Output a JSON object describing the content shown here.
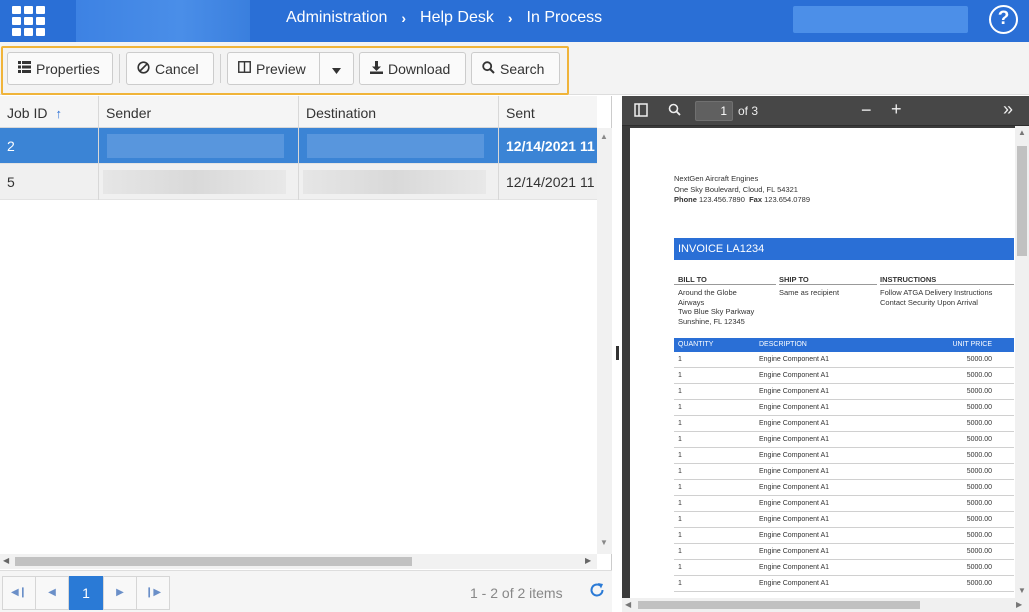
{
  "header": {
    "breadcrumb": [
      "Administration",
      "Help Desk",
      "In Process"
    ],
    "separator": "›",
    "help": "?"
  },
  "toolbar": {
    "properties": "Properties",
    "cancel": "Cancel",
    "preview": "Preview",
    "download": "Download",
    "search": "Search"
  },
  "grid": {
    "columns": {
      "job_id": "Job ID",
      "sender": "Sender",
      "destination": "Destination",
      "sent": "Sent"
    },
    "rows": [
      {
        "job_id": "2",
        "sent": "12/14/2021 11"
      },
      {
        "job_id": "5",
        "sent": "12/14/2021 11"
      }
    ],
    "pager": {
      "current_page": "1",
      "info": "1 - 2 of 2 items"
    }
  },
  "viewer": {
    "page_number": "1",
    "page_total": "of 3"
  },
  "invoice": {
    "company": "NextGen Aircraft Engines",
    "address": "One Sky Boulevard, Cloud, FL 54321",
    "phone_label": "Phone",
    "phone": "123.456.7890",
    "fax_label": "Fax",
    "fax": "123.654.0789",
    "title": "INVOICE LA1234",
    "bill_to_label": "BILL TO",
    "bill_to_1": "Around the Globe",
    "bill_to_2": "Airways",
    "bill_to_3": "Two Blue Sky Parkway",
    "bill_to_4": "Sunshine, FL 12345",
    "ship_to_label": "SHIP TO",
    "ship_to": "Same as recipient",
    "instructions_label": "INSTRUCTIONS",
    "instructions_1": "Follow ATGA Delivery Instructions",
    "instructions_2": "Contact Security Upon Arrival",
    "col_quantity": "QUANTITY",
    "col_description": "DESCRIPTION",
    "col_unit_price": "UNIT PRICE",
    "items": [
      {
        "qty": "1",
        "desc": "Engine Component A1",
        "price": "5000.00"
      },
      {
        "qty": "1",
        "desc": "Engine Component A1",
        "price": "5000.00"
      },
      {
        "qty": "1",
        "desc": "Engine Component A1",
        "price": "5000.00"
      },
      {
        "qty": "1",
        "desc": "Engine Component A1",
        "price": "5000.00"
      },
      {
        "qty": "1",
        "desc": "Engine Component A1",
        "price": "5000.00"
      },
      {
        "qty": "1",
        "desc": "Engine Component A1",
        "price": "5000.00"
      },
      {
        "qty": "1",
        "desc": "Engine Component A1",
        "price": "5000.00"
      },
      {
        "qty": "1",
        "desc": "Engine Component A1",
        "price": "5000.00"
      },
      {
        "qty": "1",
        "desc": "Engine Component A1",
        "price": "5000.00"
      },
      {
        "qty": "1",
        "desc": "Engine Component A1",
        "price": "5000.00"
      },
      {
        "qty": "1",
        "desc": "Engine Component A1",
        "price": "5000.00"
      },
      {
        "qty": "1",
        "desc": "Engine Component A1",
        "price": "5000.00"
      },
      {
        "qty": "1",
        "desc": "Engine Component A1",
        "price": "5000.00"
      },
      {
        "qty": "1",
        "desc": "Engine Component A1",
        "price": "5000.00"
      },
      {
        "qty": "1",
        "desc": "Engine Component A1",
        "price": "5000.00"
      }
    ]
  },
  "colors": {
    "header_bg": "#2a6fd6",
    "selected_row": "#3b84d5",
    "toolbar_highlight": "#f0b43a"
  }
}
